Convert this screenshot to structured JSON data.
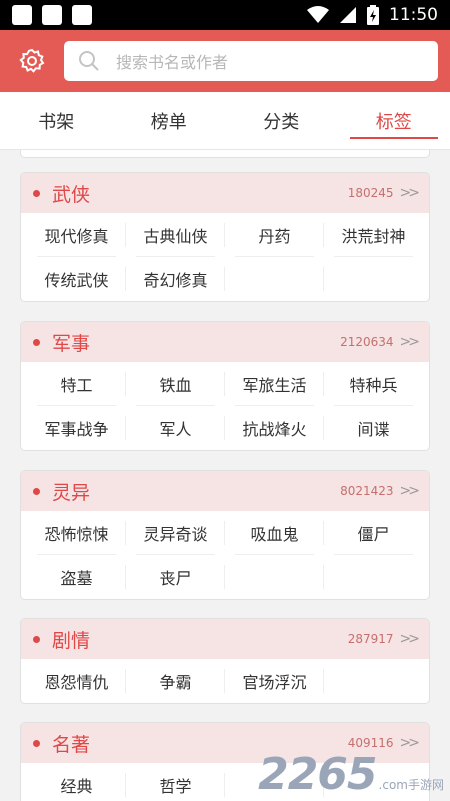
{
  "status_bar": {
    "time": "11:50"
  },
  "header": {
    "search_placeholder": "搜索书名或作者"
  },
  "tabs": [
    {
      "label": "书架"
    },
    {
      "label": "榜单"
    },
    {
      "label": "分类"
    },
    {
      "label": "标签"
    }
  ],
  "categories": [
    {
      "title": "武侠",
      "count": "180245",
      "tags": [
        "现代修真",
        "古典仙侠",
        "丹药",
        "洪荒封神",
        "传统武侠",
        "奇幻修真"
      ]
    },
    {
      "title": "军事",
      "count": "2120634",
      "tags": [
        "特工",
        "铁血",
        "军旅生活",
        "特种兵",
        "军事战争",
        "军人",
        "抗战烽火",
        "间谍"
      ]
    },
    {
      "title": "灵异",
      "count": "8021423",
      "tags": [
        "恐怖惊悚",
        "灵异奇谈",
        "吸血鬼",
        "僵尸",
        "盗墓",
        "丧尸"
      ]
    },
    {
      "title": "剧情",
      "count": "287917",
      "tags": [
        "恩怨情仇",
        "争霸",
        "官场浮沉"
      ]
    },
    {
      "title": "名著",
      "count": "409116",
      "tags": [
        "经典",
        "哲学"
      ]
    }
  ],
  "watermark": {
    "number": "2265",
    "text": ".com手游网"
  }
}
